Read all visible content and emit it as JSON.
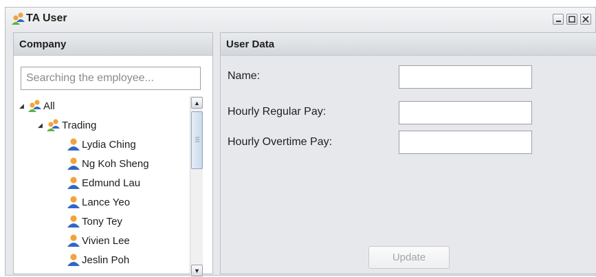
{
  "window": {
    "title": "TA User"
  },
  "company_panel": {
    "header": "Company",
    "search_placeholder": "Searching the employee...",
    "tree": [
      {
        "label": "All",
        "type": "group",
        "expanded": true,
        "level": 0
      },
      {
        "label": "Trading",
        "type": "group",
        "expanded": true,
        "level": 1
      },
      {
        "label": "Lydia Ching",
        "type": "user",
        "level": 2
      },
      {
        "label": "Ng Koh Sheng",
        "type": "user",
        "level": 2
      },
      {
        "label": "Edmund Lau",
        "type": "user",
        "level": 2
      },
      {
        "label": "Lance Yeo",
        "type": "user",
        "level": 2
      },
      {
        "label": "Tony Tey",
        "type": "user",
        "level": 2
      },
      {
        "label": "Vivien Lee",
        "type": "user",
        "level": 2
      },
      {
        "label": "Jeslin Poh",
        "type": "user",
        "level": 2
      }
    ]
  },
  "user_panel": {
    "header": "User Data",
    "fields": [
      {
        "label": "Name:",
        "value": ""
      },
      {
        "label": "Hourly Regular Pay:",
        "value": ""
      },
      {
        "label": "Hourly Overtime Pay:",
        "value": ""
      }
    ],
    "update_label": "Update",
    "update_enabled": false
  },
  "icons": {
    "group": "group-users-icon",
    "user": "user-icon"
  },
  "colors": {
    "user_head": "#f2a33c",
    "user_body": "#2f67c8",
    "accent_green": "#5fb23a"
  }
}
